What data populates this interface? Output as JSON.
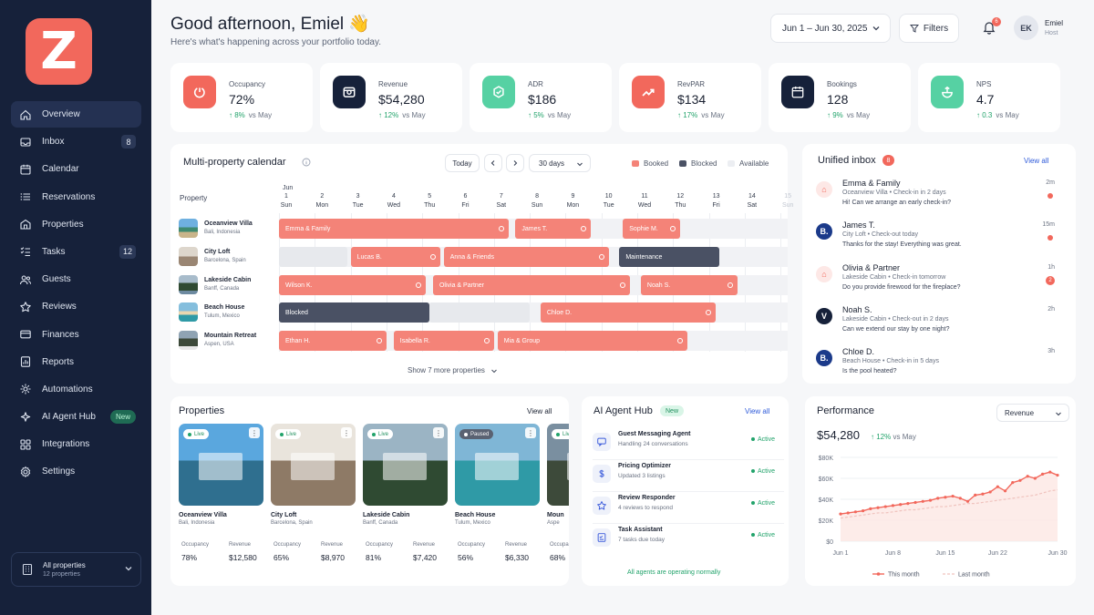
{
  "sidebar": {
    "logo_letter": "Z",
    "items": [
      {
        "label": "Overview",
        "icon": "home-icon",
        "badge": ""
      },
      {
        "label": "Inbox",
        "icon": "inbox-icon",
        "badge": "8"
      },
      {
        "label": "Calendar",
        "icon": "calendar-icon",
        "badge": ""
      },
      {
        "label": "Reservations",
        "icon": "list-icon",
        "badge": ""
      },
      {
        "label": "Properties",
        "icon": "building-icon",
        "badge": ""
      },
      {
        "label": "Tasks",
        "icon": "tasks-icon",
        "badge": "12"
      },
      {
        "label": "Guests",
        "icon": "users-icon",
        "badge": ""
      },
      {
        "label": "Reviews",
        "icon": "star-icon",
        "badge": ""
      },
      {
        "label": "Finances",
        "icon": "card-icon",
        "badge": ""
      },
      {
        "label": "Reports",
        "icon": "report-icon",
        "badge": ""
      },
      {
        "label": "Automations",
        "icon": "automation-icon",
        "badge": ""
      },
      {
        "label": "AI Agent Hub",
        "icon": "ai-icon",
        "badge": "New"
      },
      {
        "label": "Integrations",
        "icon": "integrations-icon",
        "badge": ""
      },
      {
        "label": "Settings",
        "icon": "gear-icon",
        "badge": ""
      }
    ],
    "all_properties": {
      "label": "All properties",
      "count": "12 properties"
    }
  },
  "header": {
    "greeting": "Good afternoon, Emiel 👋",
    "subtitle": "Here's what's happening across your portfolio today.",
    "date_range": "Jun 1 – Jun 30, 2025",
    "filters": "Filters",
    "notif_count": "6",
    "user": {
      "initials": "EK",
      "name": "Emiel",
      "role": "Host"
    }
  },
  "kpis": [
    {
      "label": "Occupancy",
      "value": "72%",
      "change": "8%",
      "vs": "vs May",
      "color": "#f2685c",
      "icon": "occupancy-icon"
    },
    {
      "label": "Revenue",
      "value": "$54,280",
      "change": "12%",
      "vs": "vs May",
      "color": "#16213a",
      "icon": "wallet-icon"
    },
    {
      "label": "ADR",
      "value": "$186",
      "change": "5%",
      "vs": "vs May",
      "color": "#56d1a3",
      "icon": "tag-icon"
    },
    {
      "label": "RevPAR",
      "value": "$134",
      "change": "17%",
      "vs": "vs May",
      "color": "#f2685c",
      "icon": "trend-icon"
    },
    {
      "label": "Bookings",
      "value": "128",
      "change": "9%",
      "vs": "vs May",
      "color": "#16213a",
      "icon": "calendar-icon"
    },
    {
      "label": "NPS",
      "value": "4.7",
      "change": "0.3",
      "vs": "vs May",
      "color": "#56d1a3",
      "icon": "nps-icon"
    }
  ],
  "calendar": {
    "title": "Multi-property calendar",
    "today": "Today",
    "range": "30 days",
    "legend": [
      "Booked",
      "Blocked",
      "Available"
    ],
    "property_header": "Property",
    "month": "Jun",
    "days": [
      {
        "n": "1",
        "d": "Sun"
      },
      {
        "n": "2",
        "d": "Mon"
      },
      {
        "n": "3",
        "d": "Tue"
      },
      {
        "n": "4",
        "d": "Wed"
      },
      {
        "n": "5",
        "d": "Thu"
      },
      {
        "n": "6",
        "d": "Fri"
      },
      {
        "n": "7",
        "d": "Sat"
      },
      {
        "n": "8",
        "d": "Sun"
      },
      {
        "n": "9",
        "d": "Mon"
      },
      {
        "n": "10",
        "d": "Tue"
      },
      {
        "n": "11",
        "d": "Wed"
      },
      {
        "n": "12",
        "d": "Thu"
      },
      {
        "n": "13",
        "d": "Fri"
      },
      {
        "n": "14",
        "d": "Sat"
      },
      {
        "n": "15",
        "d": "Sun"
      }
    ],
    "rows": [
      {
        "name": "Oceanview Villa",
        "loc": "Bali, Indonesia",
        "bars": [
          {
            "label": "Emma & Family",
            "type": "booked",
            "start": 1,
            "end": 7.4
          },
          {
            "label": "James T.",
            "type": "booked",
            "start": 7.6,
            "end": 9.7
          },
          {
            "label": "Sophie M.",
            "type": "booked",
            "start": 10.6,
            "end": 12.2
          }
        ]
      },
      {
        "name": "City Loft",
        "loc": "Barcelona, Spain",
        "bars": [
          {
            "label": "",
            "type": "avail",
            "start": 1,
            "end": 2.9
          },
          {
            "label": "Lucas B.",
            "type": "booked",
            "start": 3.0,
            "end": 5.5
          },
          {
            "label": "Anna & Friends",
            "type": "booked",
            "start": 5.6,
            "end": 10.2
          },
          {
            "label": "Maintenance",
            "type": "blocked",
            "start": 10.5,
            "end": 13.3
          }
        ]
      },
      {
        "name": "Lakeside Cabin",
        "loc": "Banff, Canada",
        "bars": [
          {
            "label": "Wilson K.",
            "type": "booked",
            "start": 1,
            "end": 5.1
          },
          {
            "label": "Olivia & Partner",
            "type": "booked",
            "start": 5.3,
            "end": 10.8
          },
          {
            "label": "Noah S.",
            "type": "booked",
            "start": 11.1,
            "end": 13.8
          }
        ]
      },
      {
        "name": "Beach House",
        "loc": "Tulum, Mexico",
        "bars": [
          {
            "label": "Blocked",
            "type": "blocked",
            "start": 1,
            "end": 5.2
          },
          {
            "label": "",
            "type": "avail",
            "start": 5.2,
            "end": 8.0
          },
          {
            "label": "Chloe D.",
            "type": "booked",
            "start": 8.3,
            "end": 13.2
          }
        ]
      },
      {
        "name": "Mountain Retreat",
        "loc": "Aspen, USA",
        "bars": [
          {
            "label": "Ethan H.",
            "type": "booked",
            "start": 1,
            "end": 4.0
          },
          {
            "label": "Isabella R.",
            "type": "booked",
            "start": 4.2,
            "end": 7.0
          },
          {
            "label": "Mia & Group",
            "type": "booked",
            "start": 7.1,
            "end": 12.4
          }
        ]
      }
    ],
    "show_more": "Show 7 more properties"
  },
  "inbox": {
    "title": "Unified inbox",
    "count": "8",
    "view_all": "View all",
    "messages": [
      {
        "name": "Emma & Family",
        "detail": "Oceanview Villa • Check-in in 2 days",
        "text": "Hi! Can we arrange an early check-in?",
        "time": "2m",
        "source": "airbnb",
        "unread": "dot"
      },
      {
        "name": "James T.",
        "detail": "City Loft • Check-out today",
        "text": "Thanks for the stay! Everything was great.",
        "time": "15m",
        "source": "booking",
        "unread": "dot"
      },
      {
        "name": "Olivia & Partner",
        "detail": "Lakeside Cabin • Check-in tomorrow",
        "text": "Do you provide firewood for the fireplace?",
        "time": "1h",
        "source": "airbnb",
        "unread": "2"
      },
      {
        "name": "Noah S.",
        "detail": "Lakeside Cabin • Check-out in 2 days",
        "text": "Can we extend our stay by one night?",
        "time": "2h",
        "source": "vrbo",
        "unread": ""
      },
      {
        "name": "Chloe D.",
        "detail": "Beach House • Check-in in 5 days",
        "text": "Is the pool heated?",
        "time": "3h",
        "source": "booking",
        "unread": ""
      }
    ]
  },
  "properties": {
    "title": "Properties",
    "view_all": "View all",
    "occ_label": "Occupancy",
    "rev_label": "Revenue",
    "cards": [
      {
        "name": "Oceanview Villa",
        "loc": "Bali, Indonesia",
        "status": "Live",
        "occ": "78%",
        "rev": "$12,580",
        "sky": "#5aa7de",
        "ground": "#2f6f8f"
      },
      {
        "name": "City Loft",
        "loc": "Barcelona, Spain",
        "status": "Live",
        "occ": "65%",
        "rev": "$8,970",
        "sky": "#e9e4dc",
        "ground": "#8e7a66"
      },
      {
        "name": "Lakeside Cabin",
        "loc": "Banff, Canada",
        "status": "Live",
        "occ": "81%",
        "rev": "$7,420",
        "sky": "#9bb4c4",
        "ground": "#2f4a32"
      },
      {
        "name": "Beach House",
        "loc": "Tulum, Mexico",
        "status": "Paused",
        "occ": "56%",
        "rev": "$6,330",
        "sky": "#7fb6d6",
        "ground": "#2f9aa6"
      },
      {
        "name": "Moun",
        "loc": "Aspe",
        "status": "Live",
        "occ": "68%",
        "rev": "",
        "sky": "#7a8fa0",
        "ground": "#3d4a3a"
      }
    ]
  },
  "agents": {
    "title": "AI Agent Hub",
    "badge": "New",
    "view_all": "View all",
    "items": [
      {
        "name": "Guest Messaging Agent",
        "desc": "Handling 24 conversations",
        "status": "Active",
        "icon": "chat-icon"
      },
      {
        "name": "Pricing Optimizer",
        "desc": "Updated 3 listings",
        "status": "Active",
        "icon": "price-icon"
      },
      {
        "name": "Review Responder",
        "desc": "4 reviews to respond",
        "status": "Active",
        "icon": "star-icon"
      },
      {
        "name": "Task Assistant",
        "desc": "7 tasks due today",
        "status": "Active",
        "icon": "task-icon"
      }
    ],
    "footer": "All agents are operating normally"
  },
  "performance": {
    "title": "Performance",
    "select": "Revenue",
    "value": "$54,280",
    "change": "12%",
    "vs": "vs May",
    "legend_this": "This month",
    "legend_last": "Last month",
    "color_this": "#f2685c",
    "color_last": "#f0c3be"
  },
  "chart_data": {
    "type": "line",
    "y_ticks": [
      "$80K",
      "$60K",
      "$40K",
      "$20K",
      "$0"
    ],
    "x_ticks": [
      "Jun 1",
      "Jun 8",
      "Jun 15",
      "Jun 22",
      "Jun 30"
    ],
    "ylim": [
      0,
      80
    ],
    "x": [
      1,
      2,
      3,
      4,
      5,
      6,
      7,
      8,
      9,
      10,
      11,
      12,
      13,
      14,
      15,
      16,
      17,
      18,
      19,
      20,
      21,
      22,
      23,
      24,
      25,
      26,
      27,
      28,
      29,
      30
    ],
    "series": [
      {
        "name": "This month",
        "values": [
          26,
          27,
          28,
          29,
          31,
          32,
          33,
          34,
          35,
          36,
          37,
          38,
          39,
          41,
          42,
          43,
          41,
          38,
          44,
          45,
          47,
          52,
          48,
          56,
          58,
          62,
          60,
          64,
          66,
          63
        ]
      },
      {
        "name": "Last month",
        "values": [
          22,
          23,
          24,
          25,
          26,
          27,
          27,
          28,
          29,
          30,
          30,
          31,
          32,
          33,
          33,
          34,
          35,
          36,
          36,
          37,
          38,
          39,
          40,
          41,
          42,
          43,
          44,
          46,
          48,
          49
        ]
      }
    ]
  }
}
